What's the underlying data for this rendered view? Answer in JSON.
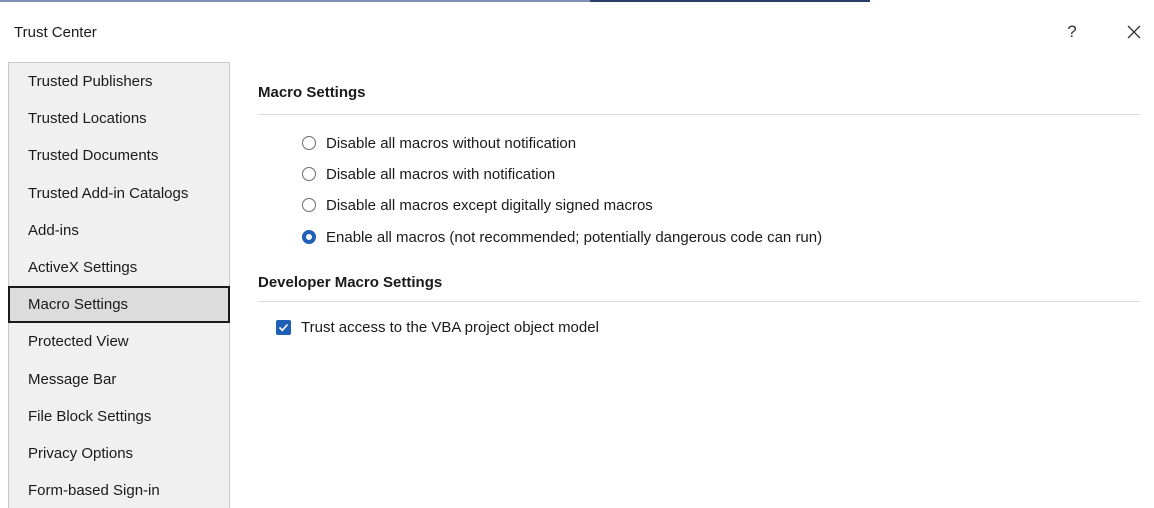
{
  "window": {
    "title": "Trust Center",
    "help_label": "?"
  },
  "sidebar": {
    "items": [
      {
        "label": "Trusted Publishers",
        "selected": false
      },
      {
        "label": "Trusted Locations",
        "selected": false
      },
      {
        "label": "Trusted Documents",
        "selected": false
      },
      {
        "label": "Trusted Add-in Catalogs",
        "selected": false
      },
      {
        "label": "Add-ins",
        "selected": false
      },
      {
        "label": "ActiveX Settings",
        "selected": false
      },
      {
        "label": "Macro Settings",
        "selected": true
      },
      {
        "label": "Protected View",
        "selected": false
      },
      {
        "label": "Message Bar",
        "selected": false
      },
      {
        "label": "File Block Settings",
        "selected": false
      },
      {
        "label": "Privacy Options",
        "selected": false
      },
      {
        "label": "Form-based Sign-in",
        "selected": false
      }
    ]
  },
  "macro_settings": {
    "header": "Macro Settings",
    "options": [
      {
        "label": "Disable all macros without notification",
        "checked": false
      },
      {
        "label": "Disable all macros with notification",
        "checked": false
      },
      {
        "label": "Disable all macros except digitally signed macros",
        "checked": false
      },
      {
        "label": "Enable all macros (not recommended; potentially dangerous code can run)",
        "checked": true
      }
    ]
  },
  "developer_settings": {
    "header": "Developer Macro Settings",
    "trust_vba_label": "Trust access to the VBA project object model",
    "trust_vba_checked": true
  },
  "colors": {
    "accent": "#1f5fb5",
    "selected_bg": "#dcdcdc",
    "sidebar_bg": "#f0f0f0"
  },
  "icons": {
    "help": "question-mark-icon",
    "close": "close-icon",
    "check": "checkmark-icon"
  }
}
